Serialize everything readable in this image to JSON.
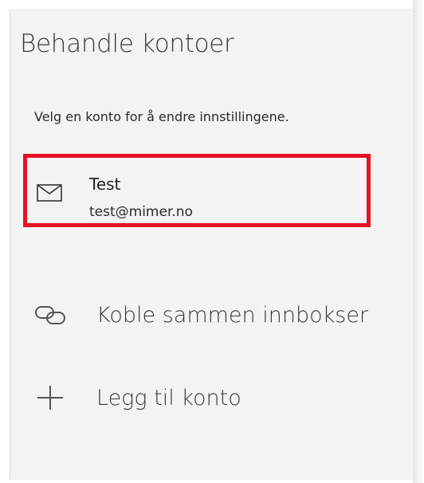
{
  "panel": {
    "title": "Behandle kontoer",
    "subtitle": "Velg en konto for å endre innstillingene."
  },
  "accounts": [
    {
      "name": "Test",
      "email": "test@mimer.no",
      "icon": "mail-icon",
      "highlighted": true
    }
  ],
  "actions": {
    "link_inboxes": {
      "label": "Koble sammen innbokser",
      "icon": "link-icon"
    },
    "add_account": {
      "label": "Legg til konto",
      "icon": "plus-icon"
    }
  },
  "colors": {
    "panel_background": "#f3f3f3",
    "highlight_border": "#e81123",
    "text": "#202020"
  }
}
